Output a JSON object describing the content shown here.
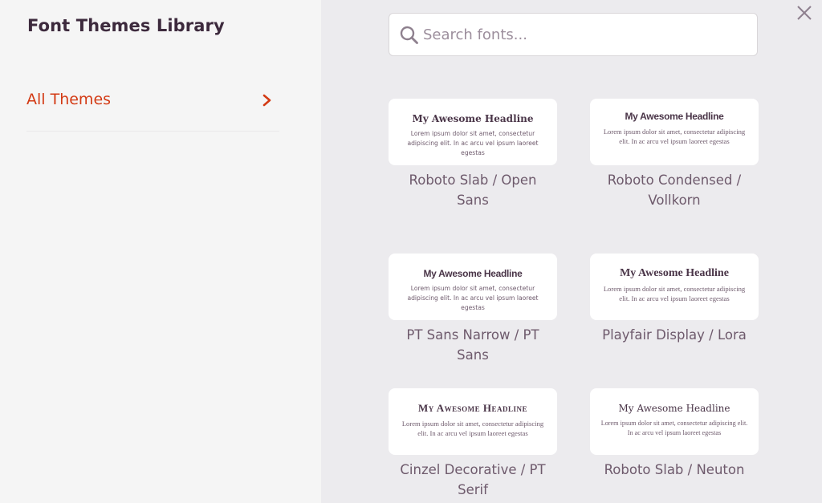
{
  "sidebar": {
    "title": "Font Themes Library",
    "items": [
      {
        "label": "All Themes",
        "icon": "chevron-right-icon",
        "active": true
      }
    ]
  },
  "search": {
    "placeholder": "Search fonts...",
    "value": "",
    "icon": "search-icon"
  },
  "close": {
    "icon": "close-icon"
  },
  "colors": {
    "accent": "#d33a14",
    "title": "#3d2a3d",
    "text": "#6e5a6c",
    "sidebar_bg": "#f5f5f5",
    "main_bg": "#ecebee"
  },
  "themes": [
    {
      "headline": "My Awesome Headline",
      "body": "Lorem ipsum dolor sit amet, consectetur adipiscing elit. In ac arcu vel ipsum laoreet egestas",
      "label": "Roboto Slab / Open Sans"
    },
    {
      "headline": "My Awesome Headline",
      "body": "Lorem ipsum dolor sit amet, consectetur adipiscing elit. In ac arcu vel ipsum laoreet egestas",
      "label": "Roboto Condensed / Vollkorn"
    },
    {
      "headline": "My Awesome Headline",
      "body": "Lorem ipsum dolor sit amet, consectetur adipiscing elit. In ac arcu vel ipsum laoreet egestas",
      "label": "PT Sans Narrow / PT Sans"
    },
    {
      "headline": "My Awesome Headline",
      "body": "Lorem ipsum dolor sit amet, consectetur adipiscing elit. In ac arcu vel ipsum laoreet egestas",
      "label": "Playfair Display / Lora"
    },
    {
      "headline": "My Awesome Headline",
      "body": "Lorem ipsum dolor sit amet, consectetur adipiscing elit. In ac arcu vel ipsum laoreet egestas",
      "label": "Cinzel Decorative / PT Serif"
    },
    {
      "headline": "My Awesome Headline",
      "body": "Lorem ipsum dolor sit amet, consectetur adipiscing elit. In ac arcu vel ipsum laoreet egestas",
      "label": "Roboto Slab / Neuton"
    }
  ]
}
